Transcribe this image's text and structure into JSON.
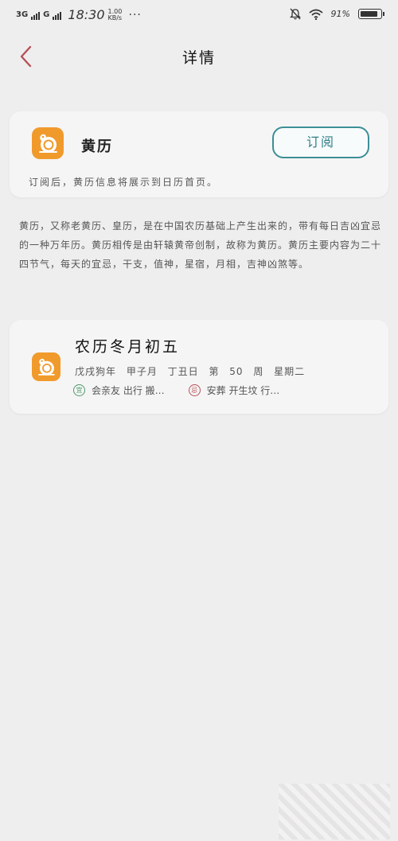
{
  "status_bar": {
    "network_1": "3G",
    "network_2": "G",
    "time": "18:30",
    "speed": "1.00 KB/s",
    "more": "···",
    "battery_text": "91%",
    "battery_level": 0.91
  },
  "nav": {
    "title": "详情"
  },
  "subscribe_card": {
    "app_name": "黄历",
    "subscribe_label": "订阅",
    "note": "订阅后，黄历信息将展示到日历首页。"
  },
  "description": "黄历，又称老黄历、皇历，是在中国农历基础上产生出来的，带有每日吉凶宜忌的一种万年历。黄历相传是由轩辕黄帝创制，故称为黄历。黄历主要内容为二十四节气，每天的宜忌，干支，值神，星宿，月相，吉神凶煞等。",
  "calendar_card": {
    "title": "农历冬月初五",
    "info": "戊戌狗年 甲子月 丁丑日 第 50 周 星期二",
    "yi_badge": "宜",
    "yi_text": "会亲友 出行 搬…",
    "ji_badge": "忌",
    "ji_text": "安葬 开生坟 行…"
  },
  "colors": {
    "accent": "#3b8f97",
    "icon_orange": "#f09a2c",
    "back_arrow": "#b5515a",
    "yi": "#4a9a6a",
    "ji": "#b5515a"
  },
  "icons": [
    "back-arrow-icon",
    "calendar-app-icon",
    "do-badge-icon",
    "avoid-badge-icon"
  ]
}
